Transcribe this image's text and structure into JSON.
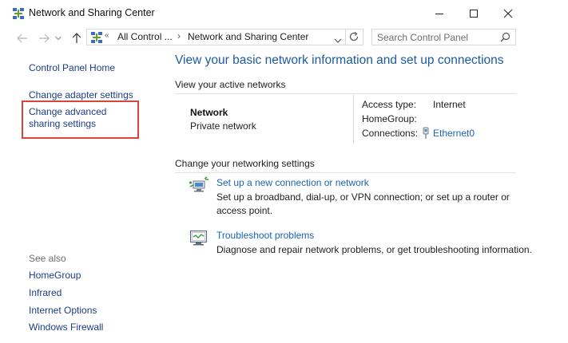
{
  "window": {
    "title": "Network and Sharing Center",
    "controls": [
      "minimize",
      "maximize",
      "close"
    ]
  },
  "nav": {
    "breadcrumb_prefix": "«",
    "breadcrumb_root": "All Control ...",
    "breadcrumb_separator": "›",
    "breadcrumb_current": "Network and Sharing Center",
    "search_placeholder": "Search Control Panel"
  },
  "sidebar": {
    "home": "Control Panel Home",
    "links": [
      "Change adapter settings",
      "Change advanced sharing settings"
    ],
    "see_also_label": "See also",
    "see_also": [
      "HomeGroup",
      "Infrared",
      "Internet Options",
      "Windows Firewall"
    ],
    "highlight_color": "#d9453a"
  },
  "main": {
    "heading": "View your basic network information and set up connections",
    "active_section": "View your active networks",
    "network": {
      "name": "Network",
      "type": "Private network",
      "access_type_label": "Access type:",
      "access_type_value": "Internet",
      "homegroup_label": "HomeGroup:",
      "homegroup_value": "",
      "connections_label": "Connections:",
      "connection_name": "Ethernet0"
    },
    "change_section": "Change your networking settings",
    "tasks": [
      {
        "title": "Set up a new connection or network",
        "description": "Set up a broadband, dial-up, or VPN connection; or set up a router or access point.",
        "icon": "new-connection-icon"
      },
      {
        "title": "Troubleshoot problems",
        "description": "Diagnose and repair network problems, or get troubleshooting information.",
        "icon": "troubleshoot-icon"
      }
    ]
  },
  "colors": {
    "heading": "#1e5aa0",
    "link": "#1a63b8",
    "sidebar_link": "#1a3d86"
  }
}
